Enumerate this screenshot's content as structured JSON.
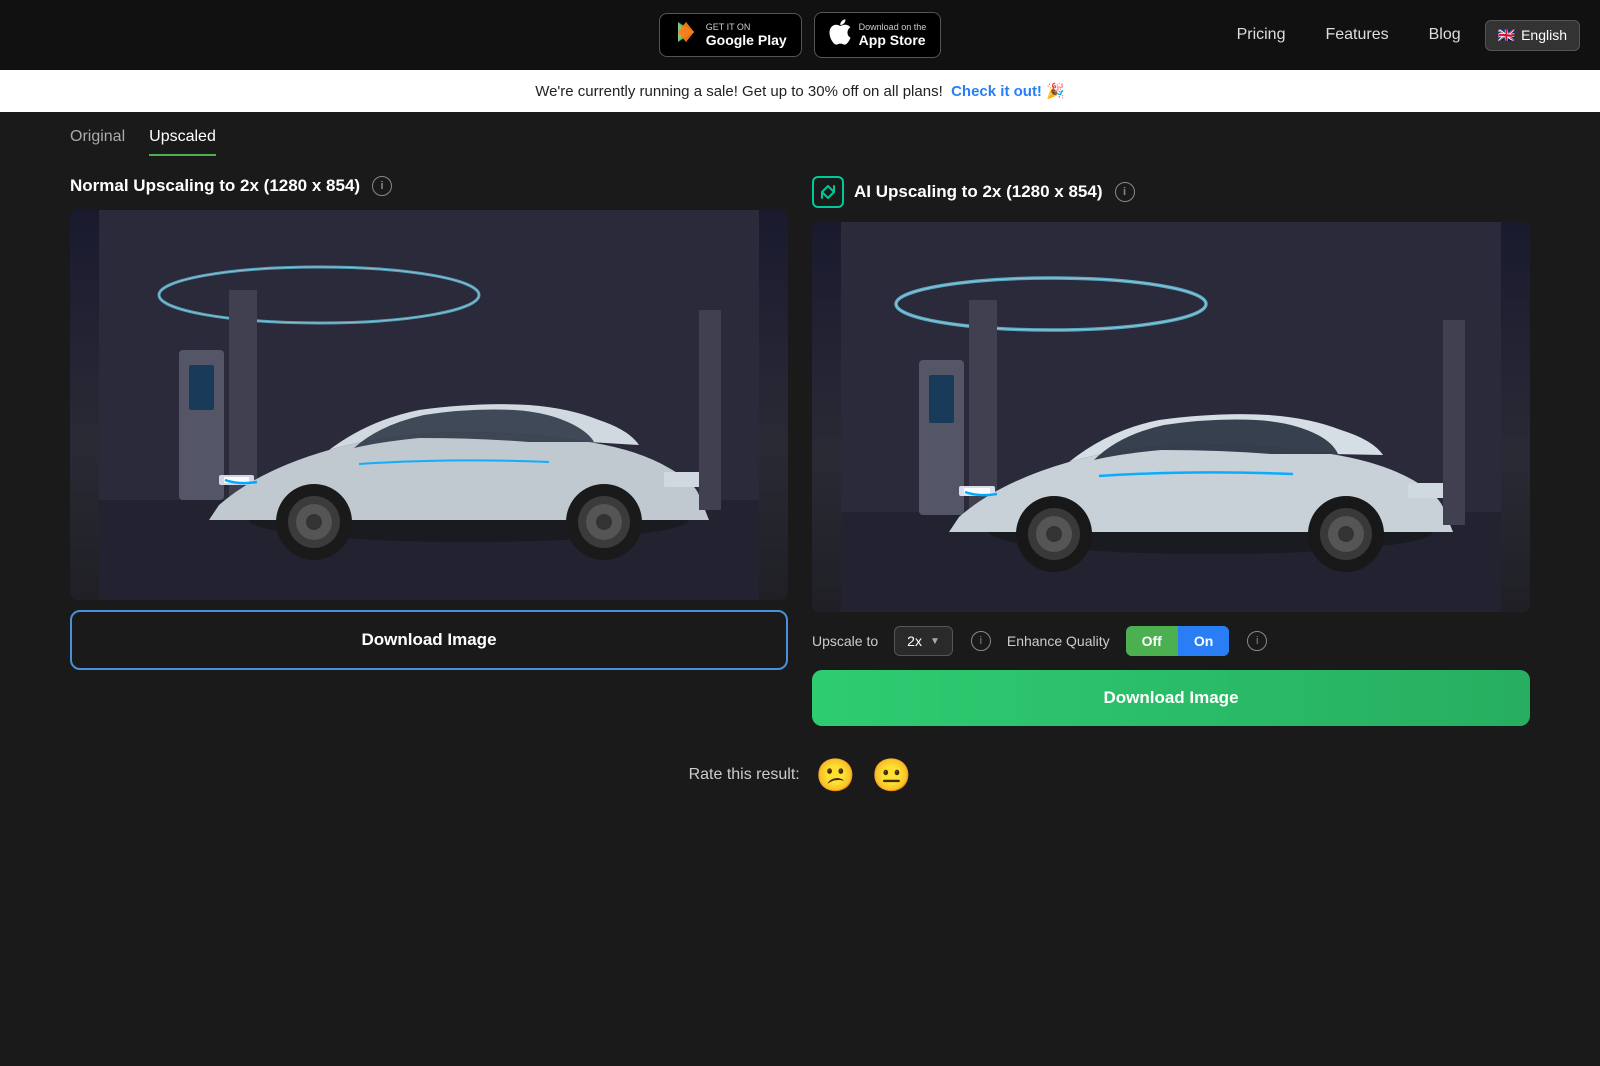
{
  "header": {
    "google_play_badge_top": "GET IT ON",
    "google_play_badge_bottom": "Google Play",
    "app_store_badge_top": "Download on the",
    "app_store_badge_bottom": "App Store",
    "nav_links": [
      "Pricing",
      "Features",
      "Blog"
    ],
    "language_flag": "🇬🇧",
    "language_label": "English"
  },
  "sale_banner": {
    "text": "We're currently running a sale! Get up to 30% off on all plans!",
    "link_text": "Check it out! 🎉"
  },
  "tabs": [
    "Original",
    "Upscaled"
  ],
  "active_tab": "Upscaled",
  "left_column": {
    "title": "Normal Upscaling to 2x (1280 x 854)",
    "download_button": "Download Image"
  },
  "right_column": {
    "title": "AI Upscaling to 2x (1280 x 854)",
    "upscale_label": "Upscale to",
    "upscale_value": "2x",
    "enhance_label": "Enhance Quality",
    "toggle_off": "Off",
    "toggle_on": "On",
    "download_button": "Download Image"
  },
  "rate_section": {
    "label": "Rate this result:",
    "emoji1": "😕",
    "emoji2": "😐"
  },
  "colors": {
    "green_accent": "#4caf50",
    "blue_accent": "#4a90d9",
    "download_green": "#2ecc71",
    "ai_icon_color": "#00c896"
  }
}
